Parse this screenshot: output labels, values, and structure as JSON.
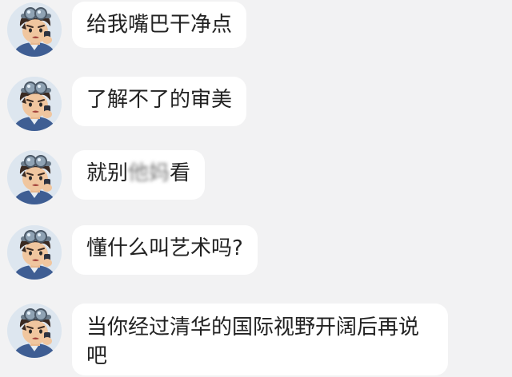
{
  "messages": [
    {
      "text": "给我嘴巴干净点",
      "avatar_icon": "cartoon-boy-avatar-icon"
    },
    {
      "text": "了解不了的审美",
      "avatar_icon": "cartoon-boy-avatar-icon"
    },
    {
      "text_before": "就别",
      "text_obscured": "他妈",
      "text_after": "看",
      "avatar_icon": "cartoon-boy-avatar-icon"
    },
    {
      "text": "懂什么叫艺术吗?",
      "avatar_icon": "cartoon-boy-avatar-icon"
    },
    {
      "text": "当你经过清华的国际视野开阔后再说吧",
      "avatar_icon": "cartoon-boy-avatar-icon"
    }
  ],
  "colors": {
    "background": "#f2f2f3",
    "bubble": "#ffffff",
    "text": "#222222"
  }
}
